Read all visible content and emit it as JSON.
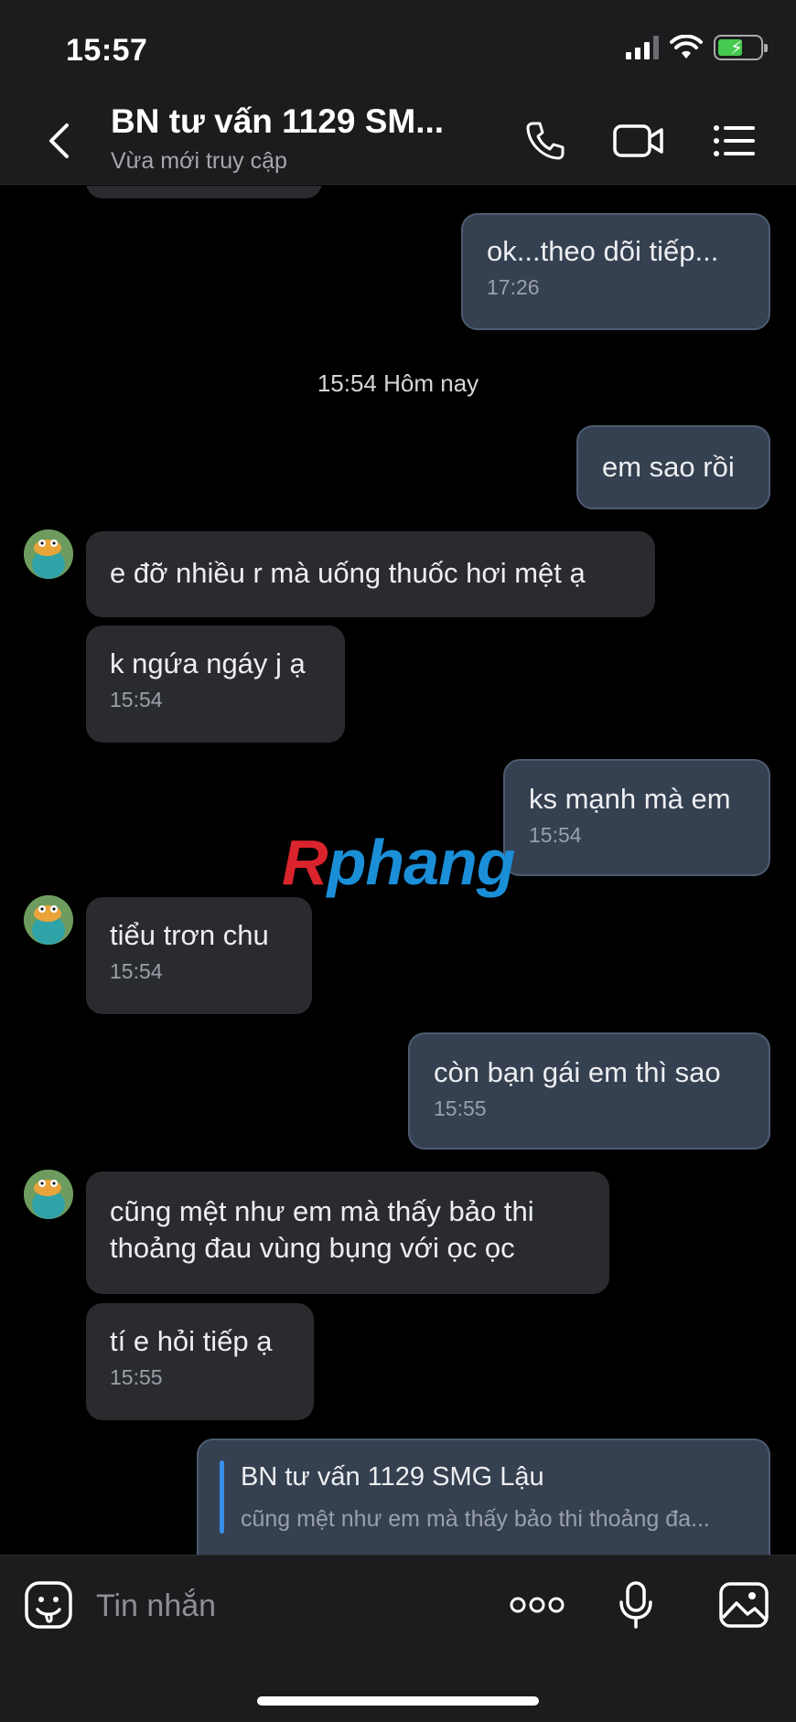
{
  "status_bar": {
    "time": "15:57"
  },
  "header": {
    "title": "BN tư vấn 1129 SM...",
    "subtitle": "Vừa mới truy cập"
  },
  "messages": {
    "m1": {
      "text": "ok...theo dõi tiếp...",
      "time": "17:26"
    },
    "date_separator": "15:54 Hôm nay",
    "m2": {
      "text": "em sao rồi"
    },
    "m3": {
      "text": "e đỡ nhiều r mà uống thuốc hơi mệt ạ"
    },
    "m4": {
      "text": "k ngứa ngáy j ạ",
      "time": "15:54"
    },
    "m5": {
      "text": "ks mạnh mà em",
      "time": "15:54"
    },
    "m6": {
      "text": "tiểu trơn chu",
      "time": "15:54"
    },
    "m7": {
      "text": "còn bạn gái em thì sao",
      "time": "15:55"
    },
    "m8": {
      "line1": "cũng mệt như em mà thấy bảo thi",
      "line2": "thoảng đau vùng bụng với ọc ọc"
    },
    "m9": {
      "text": "tí e hỏi tiếp ạ",
      "time": "15:55"
    },
    "reply": {
      "quoted_name": "BN tư vấn 1129 SMG Lậu",
      "quoted_text": "cũng mệt như em mà thấy bảo thi thoảng đa..."
    }
  },
  "watermark": {
    "first": "R",
    "rest": "phang"
  },
  "input_bar": {
    "placeholder": "Tin nhắn"
  },
  "colors": {
    "incoming_bubble": "#2a2b2e",
    "outgoing_bubble": "#354050",
    "accent": "#3a8ee8"
  },
  "icons": [
    "back-icon",
    "phone-icon",
    "video-call-icon",
    "menu-list-icon",
    "sticker-icon",
    "more-icon",
    "microphone-icon",
    "image-icon"
  ]
}
